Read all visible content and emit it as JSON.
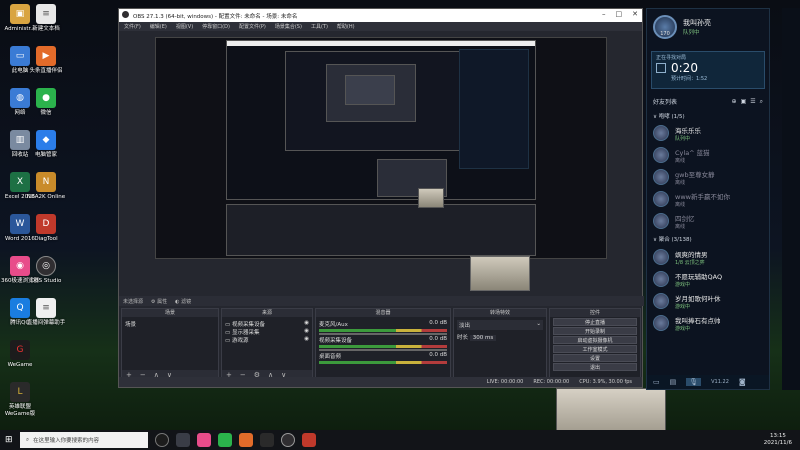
{
  "desktop": {
    "icons": [
      {
        "label": "Administr...",
        "color": "#d9a441",
        "glyph": "📁"
      },
      {
        "label": "新建文本档",
        "color": "#e8e8e8",
        "glyph": "📄"
      },
      {
        "label": "此电脑",
        "color": "#3a7bd5",
        "glyph": "🖥"
      },
      {
        "label": "头条直播伴侣",
        "color": "#e36b2a",
        "glyph": "▶"
      },
      {
        "label": "网络",
        "color": "#3a7bd5",
        "glyph": "🌐"
      },
      {
        "label": "微信",
        "color": "#2bb24c",
        "glyph": "●"
      },
      {
        "label": "回收站",
        "color": "#7a8aa0",
        "glyph": "🗑"
      },
      {
        "label": "电脑管家",
        "color": "#2b7de9",
        "glyph": "◆"
      },
      {
        "label": "Excel 2016",
        "color": "#1d7044",
        "glyph": "X"
      },
      {
        "label": "NBA2K Online",
        "color": "#c98b2a",
        "glyph": "N"
      },
      {
        "label": "Word 2016",
        "color": "#2b579a",
        "glyph": "W"
      },
      {
        "label": "DiagTool",
        "color": "#c0392b",
        "glyph": "D"
      },
      {
        "label": "360极速浏览器",
        "color": "#e84c8a",
        "glyph": "◉"
      },
      {
        "label": "OBS Studio",
        "color": "#302e31",
        "glyph": "◎"
      },
      {
        "label": "腾讯QQ",
        "color": "#1a7de0",
        "glyph": "Q"
      },
      {
        "label": "直播间弹幕助手",
        "color": "#f0f0f0",
        "glyph": "📄"
      },
      {
        "label": "WeGame",
        "color": "#1c1c1c",
        "glyph": "G"
      },
      {
        "label": "英雄联盟 WeGame版",
        "color": "#2a2a2a",
        "glyph": "L"
      }
    ]
  },
  "obs": {
    "title": "OBS 27.1.3 (64-bit, windows) - 配置文件: 未命名 - 场景: 未命名",
    "menu": [
      "文件(F)",
      "编辑(E)",
      "视图(V)",
      "停靠窗口(D)",
      "配置文件(P)",
      "场景集合(S)",
      "工具(T)",
      "帮助(H)"
    ],
    "no_source_label": "未选择源",
    "properties_label": "属性",
    "filters_label": "滤镜",
    "docks": {
      "scenes": {
        "title": "场景",
        "items": [
          "场景"
        ]
      },
      "sources": {
        "title": "来源",
        "items": [
          "视频采集设备",
          "显示器采集",
          "游戏源"
        ]
      },
      "mixer": {
        "title": "混音器",
        "channels": [
          {
            "name": "麦克风/Aux",
            "db": "0.0 dB"
          },
          {
            "name": "视频采集设备",
            "db": "0.0 dB"
          },
          {
            "name": "桌面音频",
            "db": "0.0 dB"
          }
        ]
      },
      "transitions": {
        "title": "转场特效",
        "type": "淡出",
        "duration_label": "时长",
        "duration": "300 ms"
      },
      "controls": {
        "title": "控件",
        "buttons": [
          "停止直播",
          "开始录制",
          "启动虚拟摄像机",
          "工作室模式",
          "设置",
          "退出"
        ]
      }
    },
    "status": {
      "live": "LIVE: 00:00:00",
      "rec": "REC: 00:00:00",
      "cpu": "CPU: 3.9%, 30.00 fps"
    }
  },
  "taskbar": {
    "search_placeholder": "在这里输入你要搜索的内容",
    "time": "13:15",
    "date": "2021/11/6"
  },
  "game_client": {
    "user_name": "我叫孙亮",
    "user_status": "队列中",
    "level": "170",
    "queue_label": "正在寻找对局",
    "queue_timer": "0:20",
    "queue_estimate": "预计时间：1:52",
    "friends_label": "好友列表",
    "group1_label": "咆哮 (1/5)",
    "group1": [
      {
        "name": "海乐乐乐",
        "status": "队列中",
        "online": true
      },
      {
        "name": "Cyla^ 蓝猫",
        "status": "离线",
        "online": false
      },
      {
        "name": "gwb至尊女静",
        "status": "离线",
        "online": false
      },
      {
        "name": "www新手赢不如你",
        "status": "离线",
        "online": false
      },
      {
        "name": "四剑忆",
        "status": "离线",
        "online": false
      }
    ],
    "group2_label": "聚合 (3/138)",
    "group2": [
      {
        "name": "飒爽的情男",
        "status": "1/8 云顶之弈",
        "online": true
      },
      {
        "name": "不愿玩辅助QAQ",
        "status": "游戏中",
        "online": true
      },
      {
        "name": "岁月如歌何叶休",
        "status": "游戏中",
        "online": true
      },
      {
        "name": "我叫捧石有点帅",
        "status": "游戏中",
        "online": true
      }
    ],
    "version": "V11.22"
  }
}
